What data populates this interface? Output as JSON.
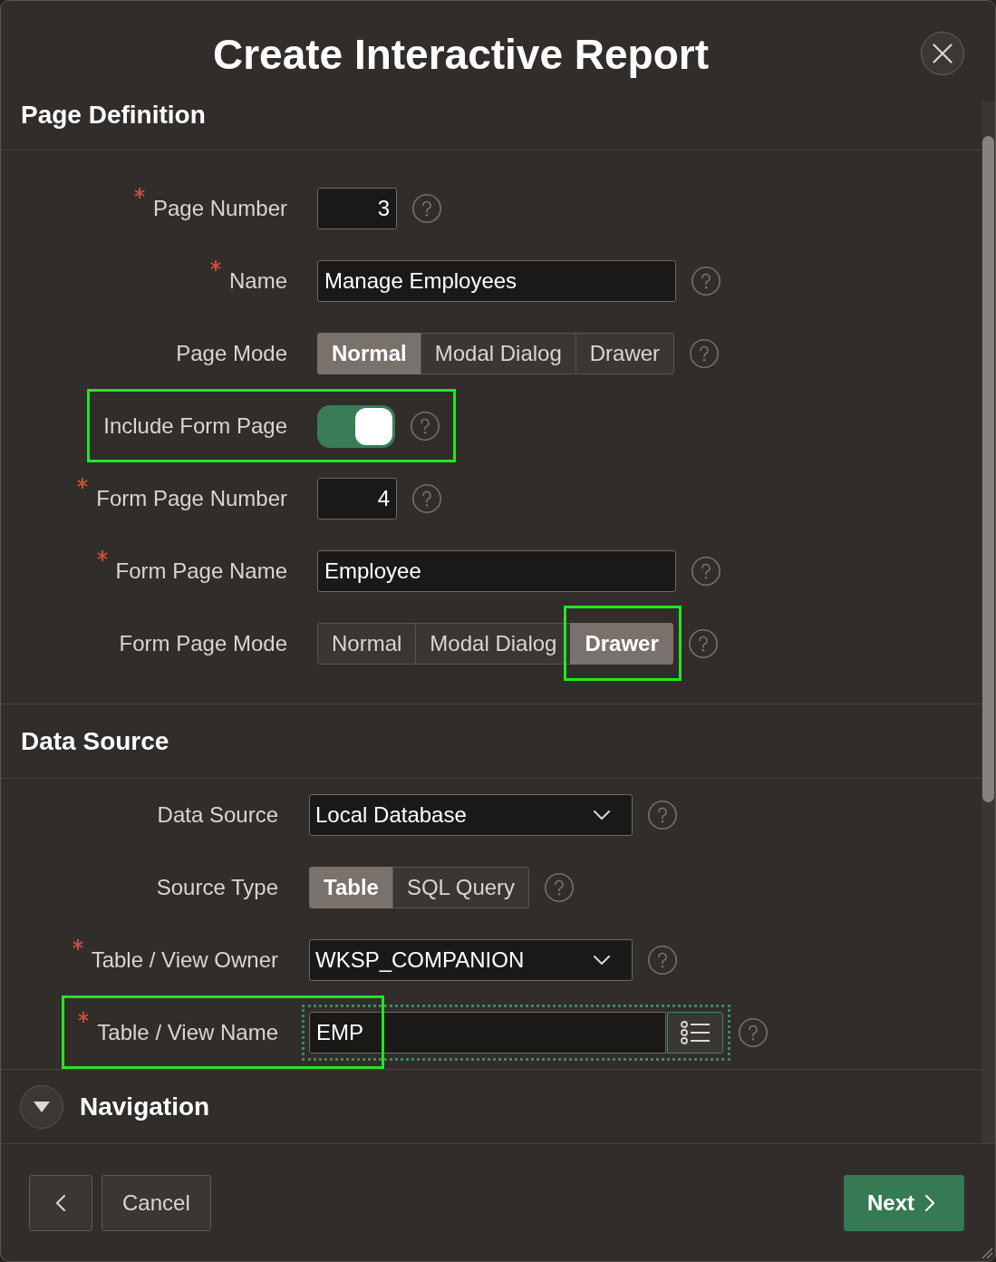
{
  "dialog": {
    "title": "Create Interactive Report"
  },
  "sections": [
    {
      "title": "Page Definition",
      "kind": "region",
      "fields": [
        {
          "kind": "number",
          "label": "Page Number",
          "required": true,
          "highlighted": false,
          "focused": false,
          "value": "3"
        },
        {
          "kind": "text",
          "label": "Name",
          "required": true,
          "highlighted": false,
          "focused": false,
          "value": "Manage Employees"
        },
        {
          "kind": "segmented",
          "label": "Page Mode",
          "required": false,
          "highlighted": false,
          "focused": false,
          "options": [
            {
              "label": "Normal",
              "selected": true,
              "highlighted": false
            },
            {
              "label": "Modal Dialog",
              "selected": false,
              "highlighted": false
            },
            {
              "label": "Drawer",
              "selected": false,
              "highlighted": false
            }
          ]
        },
        {
          "kind": "switch",
          "label": "Include Form Page",
          "required": false,
          "highlighted": true,
          "focused": false,
          "on": true
        },
        {
          "kind": "number",
          "label": "Form Page Number",
          "required": true,
          "highlighted": false,
          "focused": false,
          "value": "4"
        },
        {
          "kind": "text",
          "label": "Form Page Name",
          "required": true,
          "highlighted": false,
          "focused": false,
          "value": "Employee"
        },
        {
          "kind": "segmented",
          "label": "Form Page Mode",
          "required": false,
          "highlighted": false,
          "focused": false,
          "options": [
            {
              "label": "Normal",
              "selected": false,
              "highlighted": false
            },
            {
              "label": "Modal Dialog",
              "selected": false,
              "highlighted": false
            },
            {
              "label": "Drawer",
              "selected": true,
              "highlighted": true
            }
          ]
        }
      ]
    },
    {
      "title": "Data Source",
      "kind": "region",
      "fields": [
        {
          "kind": "select",
          "label": "Data Source",
          "required": false,
          "highlighted": false,
          "focused": false,
          "value": "Local Database"
        },
        {
          "kind": "segmented",
          "label": "Source Type",
          "required": false,
          "highlighted": false,
          "focused": false,
          "options": [
            {
              "label": "Table",
              "selected": true,
              "highlighted": false
            },
            {
              "label": "SQL Query",
              "selected": false,
              "highlighted": false
            }
          ]
        },
        {
          "kind": "select",
          "label": "Table / View Owner",
          "required": true,
          "highlighted": false,
          "focused": false,
          "value": "WKSP_COMPANION"
        },
        {
          "kind": "popup_lov",
          "label": "Table / View Name",
          "required": true,
          "highlighted": true,
          "focused": true,
          "value": "EMP"
        }
      ]
    },
    {
      "title": "Navigation",
      "kind": "collapsible",
      "expanded": false
    }
  ],
  "footer": {
    "buttons": [
      {
        "kind": "back"
      },
      {
        "kind": "secondary",
        "label": "Cancel"
      },
      {
        "kind": "primary",
        "label": "Next"
      }
    ]
  }
}
